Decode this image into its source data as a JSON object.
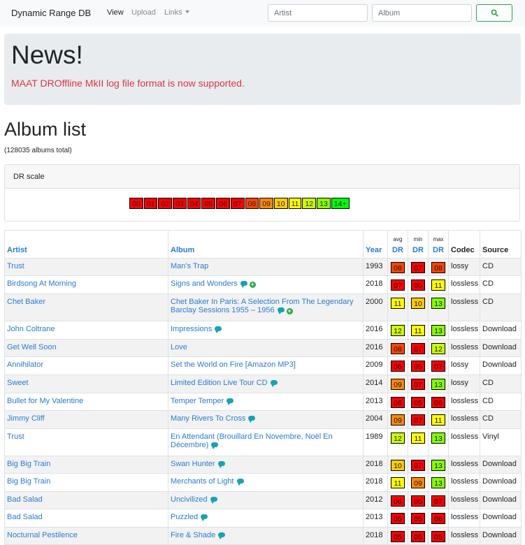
{
  "navbar": {
    "brand": "Dynamic Range DB",
    "links": [
      {
        "label": "View",
        "active": true
      },
      {
        "label": "Upload",
        "active": false
      },
      {
        "label": "Links",
        "active": false
      }
    ],
    "artist_placeholder": "Artist",
    "album_placeholder": "Album"
  },
  "news": {
    "title": "News!",
    "text": "MAAT DROffline MkII log file format is now supported."
  },
  "album_list": {
    "title": "Album list",
    "count": "(128035 albums total)"
  },
  "dr_scale": {
    "header": "DR scale",
    "items": [
      {
        "label": "00",
        "color": "#ff0000"
      },
      {
        "label": "01",
        "color": "#ff0000"
      },
      {
        "label": "02",
        "color": "#ff0000"
      },
      {
        "label": "03",
        "color": "#ff0000"
      },
      {
        "label": "04",
        "color": "#ff0000"
      },
      {
        "label": "05",
        "color": "#ff0000"
      },
      {
        "label": "06",
        "color": "#ff0000"
      },
      {
        "label": "07",
        "color": "#ff0000"
      },
      {
        "label": "08",
        "color": "#ff4400"
      },
      {
        "label": "09",
        "color": "#ff8800"
      },
      {
        "label": "10",
        "color": "#ffcc00"
      },
      {
        "label": "11",
        "color": "#ffff00"
      },
      {
        "label": "12",
        "color": "#ccff00"
      },
      {
        "label": "13",
        "color": "#88ff00"
      },
      {
        "label": "14+",
        "color": "#00ff00"
      }
    ]
  },
  "table": {
    "headers": {
      "artist": "Artist",
      "album": "Album",
      "year": "Year",
      "avg": "avg",
      "min": "min",
      "max": "max",
      "dr": "DR",
      "codec": "Codec",
      "source": "Source"
    },
    "rows": [
      {
        "artist": "Trust",
        "album": "Man’s Trap",
        "comment": false,
        "plus": false,
        "year": "1993",
        "avg": "08",
        "min": "07",
        "max": "08",
        "codec": "lossy",
        "source": "CD"
      },
      {
        "artist": "Birdsong At Morning",
        "album": "Signs and Wonders",
        "comment": true,
        "plus": true,
        "year": "2018",
        "avg": "07",
        "min": "05",
        "max": "11",
        "codec": "lossless",
        "source": "CD"
      },
      {
        "artist": "Chet Baker",
        "album": "Chet Baker In Paris: A Selection From The Legendary Barclay Sessions 1955 – 1956",
        "comment": true,
        "plus": true,
        "year": "2000",
        "avg": "11",
        "min": "10",
        "max": "13",
        "codec": "lossless",
        "source": "CD"
      },
      {
        "artist": "John Coltrane",
        "album": "Impressions",
        "comment": true,
        "plus": false,
        "year": "2016",
        "avg": "12",
        "min": "11",
        "max": "13",
        "codec": "lossless",
        "source": "Download"
      },
      {
        "artist": "Get Well Soon",
        "album": "Love",
        "comment": false,
        "plus": false,
        "year": "2016",
        "avg": "08",
        "min": "07",
        "max": "12",
        "codec": "lossless",
        "source": "Download"
      },
      {
        "artist": "Annihilator",
        "album": "Set the World on Fire [Amazon MP3]",
        "comment": false,
        "plus": false,
        "year": "2009",
        "avg": "06",
        "min": "05",
        "max": "07",
        "codec": "lossy",
        "source": "Download"
      },
      {
        "artist": "Sweet",
        "album": "Limited Edition Live Tour CD",
        "comment": true,
        "plus": false,
        "year": "2014",
        "avg": "09",
        "min": "07",
        "max": "13",
        "codec": "lossy",
        "source": "CD"
      },
      {
        "artist": "Bullet for My Valentine",
        "album": "Temper Temper",
        "comment": true,
        "plus": false,
        "year": "2013",
        "avg": "06",
        "min": "05",
        "max": "06",
        "codec": "lossless",
        "source": "CD"
      },
      {
        "artist": "Jimmy Cliff",
        "album": "Many Rivers To Cross",
        "comment": true,
        "plus": false,
        "year": "2004",
        "avg": "09",
        "min": "07",
        "max": "11",
        "codec": "lossless",
        "source": "CD"
      },
      {
        "artist": "Trust",
        "album": "En Attendant (Brouillard En Novembre, Noël En Décembre)",
        "comment": true,
        "plus": false,
        "year": "1989",
        "avg": "12",
        "min": "11",
        "max": "13",
        "codec": "lossless",
        "source": "Vinyl"
      },
      {
        "artist": "Big Big Train",
        "album": "Swan Hunter",
        "comment": true,
        "plus": false,
        "year": "2018",
        "avg": "10",
        "min": "07",
        "max": "13",
        "codec": "lossless",
        "source": "Download"
      },
      {
        "artist": "Big Big Train",
        "album": "Merchants of Light",
        "comment": true,
        "plus": false,
        "year": "2018",
        "avg": "11",
        "min": "09",
        "max": "13",
        "codec": "lossless",
        "source": "Download"
      },
      {
        "artist": "Bad Salad",
        "album": "Uncivilized",
        "comment": true,
        "plus": false,
        "year": "2012",
        "avg": "06",
        "min": "05",
        "max": "07",
        "codec": "lossless",
        "source": "Download"
      },
      {
        "artist": "Bad Salad",
        "album": "Puzzled",
        "comment": true,
        "plus": false,
        "year": "2013",
        "avg": "05",
        "min": "05",
        "max": "06",
        "codec": "lossless",
        "source": "Download"
      },
      {
        "artist": "Nocturnal Pestilence",
        "album": "Fire & Shade",
        "comment": true,
        "plus": false,
        "year": "2018",
        "avg": "05",
        "min": "05",
        "max": "05",
        "codec": "lossless",
        "source": "Download"
      }
    ]
  }
}
